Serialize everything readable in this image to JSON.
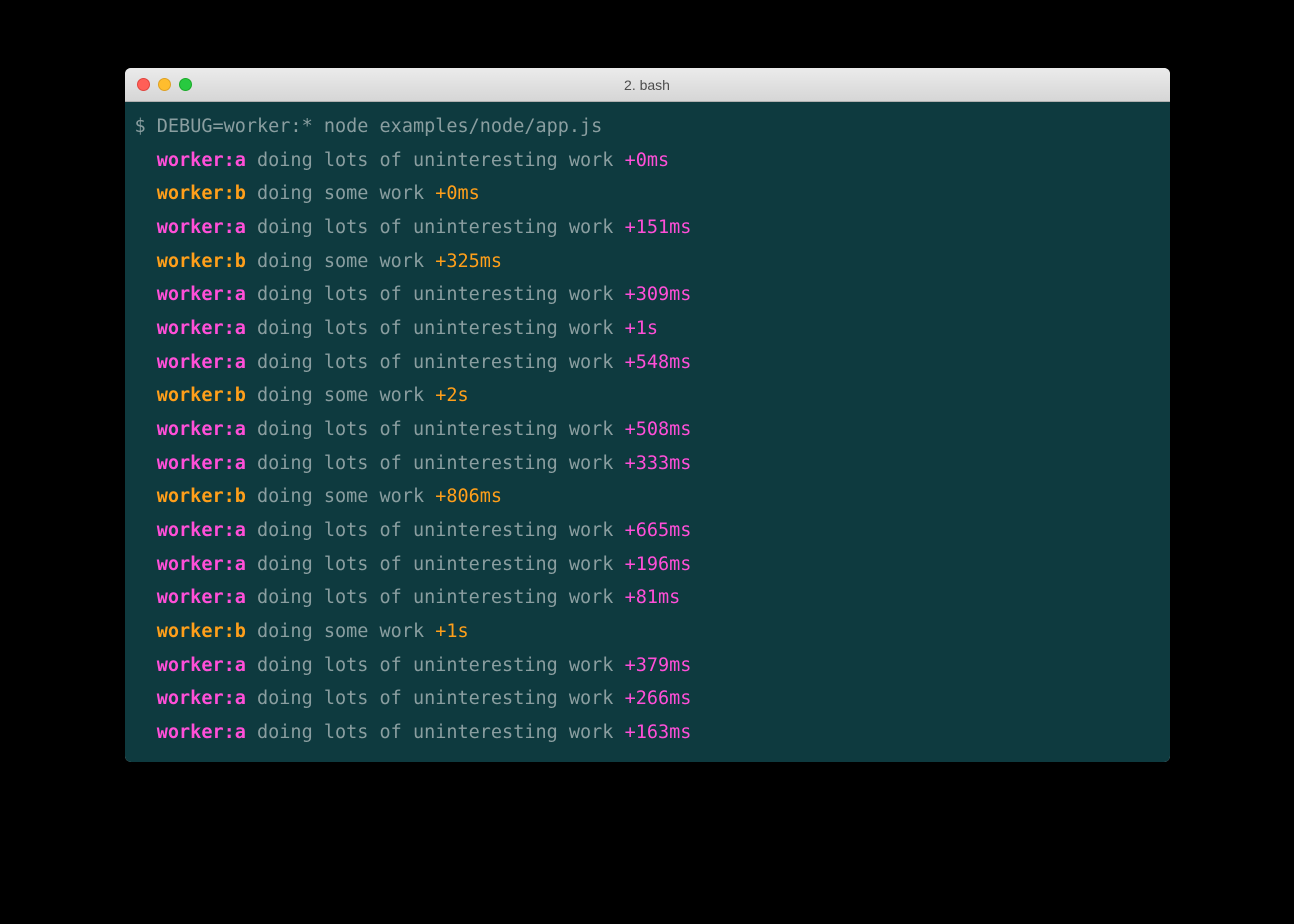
{
  "window": {
    "title": "2. bash"
  },
  "prompt": "$ ",
  "command": "DEBUG=worker:* node examples/node/app.js",
  "colors": {
    "worker_a": "#ff4fd8",
    "worker_b": "#ff9f1a",
    "background": "#0e3a3f",
    "text": "#8a9ea0"
  },
  "lines": [
    {
      "ns": "worker:a",
      "msg": "doing lots of uninteresting work",
      "time": "+0ms",
      "type": "a"
    },
    {
      "ns": "worker:b",
      "msg": "doing some work",
      "time": "+0ms",
      "type": "b"
    },
    {
      "ns": "worker:a",
      "msg": "doing lots of uninteresting work",
      "time": "+151ms",
      "type": "a"
    },
    {
      "ns": "worker:b",
      "msg": "doing some work",
      "time": "+325ms",
      "type": "b"
    },
    {
      "ns": "worker:a",
      "msg": "doing lots of uninteresting work",
      "time": "+309ms",
      "type": "a"
    },
    {
      "ns": "worker:a",
      "msg": "doing lots of uninteresting work",
      "time": "+1s",
      "type": "a"
    },
    {
      "ns": "worker:a",
      "msg": "doing lots of uninteresting work",
      "time": "+548ms",
      "type": "a"
    },
    {
      "ns": "worker:b",
      "msg": "doing some work",
      "time": "+2s",
      "type": "b"
    },
    {
      "ns": "worker:a",
      "msg": "doing lots of uninteresting work",
      "time": "+508ms",
      "type": "a"
    },
    {
      "ns": "worker:a",
      "msg": "doing lots of uninteresting work",
      "time": "+333ms",
      "type": "a"
    },
    {
      "ns": "worker:b",
      "msg": "doing some work",
      "time": "+806ms",
      "type": "b"
    },
    {
      "ns": "worker:a",
      "msg": "doing lots of uninteresting work",
      "time": "+665ms",
      "type": "a"
    },
    {
      "ns": "worker:a",
      "msg": "doing lots of uninteresting work",
      "time": "+196ms",
      "type": "a"
    },
    {
      "ns": "worker:a",
      "msg": "doing lots of uninteresting work",
      "time": "+81ms",
      "type": "a"
    },
    {
      "ns": "worker:b",
      "msg": "doing some work",
      "time": "+1s",
      "type": "b"
    },
    {
      "ns": "worker:a",
      "msg": "doing lots of uninteresting work",
      "time": "+379ms",
      "type": "a"
    },
    {
      "ns": "worker:a",
      "msg": "doing lots of uninteresting work",
      "time": "+266ms",
      "type": "a"
    },
    {
      "ns": "worker:a",
      "msg": "doing lots of uninteresting work",
      "time": "+163ms",
      "type": "a"
    }
  ]
}
